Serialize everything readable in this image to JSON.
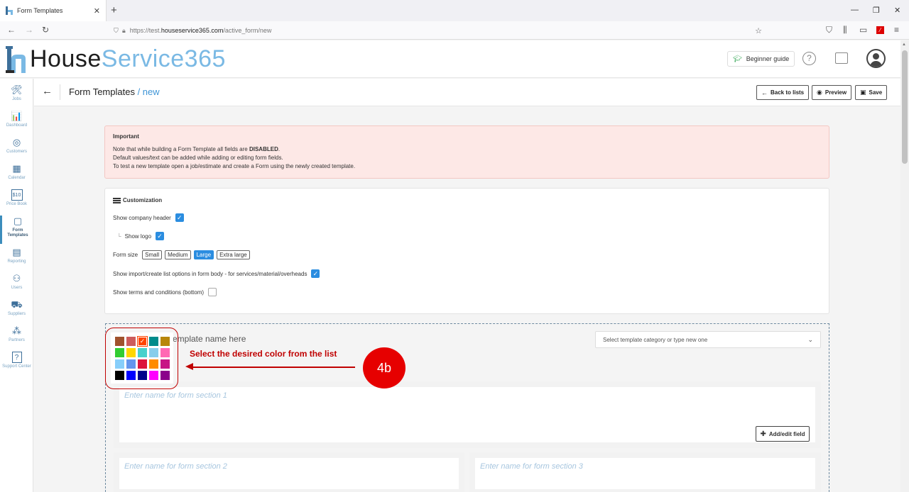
{
  "browser": {
    "tab_title": "Form Templates",
    "url_prefix": "https://test.",
    "url_domain": "houseservice365.com",
    "url_path": "/active_form/new"
  },
  "app": {
    "logo_part1": "House",
    "logo_part2": "Service365",
    "beginner_guide": "Beginner guide",
    "help_symbol": "?"
  },
  "sidebar": {
    "items": [
      {
        "label": "Jobs",
        "icon": "tools-icon",
        "glyph": "🛠"
      },
      {
        "label": "Dashboard",
        "icon": "chart-icon",
        "glyph": "📊"
      },
      {
        "label": "Customers",
        "icon": "target-icon",
        "glyph": "◎"
      },
      {
        "label": "Calendar",
        "icon": "calendar-icon",
        "glyph": "▦"
      },
      {
        "label": "Price Book",
        "icon": "pricebook-icon",
        "glyph": "$10"
      },
      {
        "label": "Form Templates",
        "icon": "form-icon",
        "glyph": "▢"
      },
      {
        "label": "Reporting",
        "icon": "report-icon",
        "glyph": "▤"
      },
      {
        "label": "Users",
        "icon": "users-icon",
        "glyph": "⚇"
      },
      {
        "label": "Suppliers",
        "icon": "truck-icon",
        "glyph": "⛟"
      },
      {
        "label": "Partners",
        "icon": "network-icon",
        "glyph": "⁂"
      },
      {
        "label": "Support Center",
        "icon": "support-icon",
        "glyph": "?"
      }
    ]
  },
  "page": {
    "title": "Form Templates",
    "title_sub": " / new",
    "back_to_lists": "Back to lists",
    "preview": "Preview",
    "save": "Save"
  },
  "important": {
    "title": "Important",
    "line1_a": "Note that while building a Form Template all fields are ",
    "line1_b": "DISABLED",
    "line1_c": ".",
    "line2": "Default values/text can be added while adding or editing form fields.",
    "line3": "To test a new template open a job/estimate and create a Form using the newly created template."
  },
  "customization": {
    "title": "Customization",
    "show_company_header": "Show company header",
    "show_logo": "Show logo",
    "form_size_label": "Form size",
    "sizes": [
      "Small",
      "Medium",
      "Large",
      "Extra large"
    ],
    "selected_size": "Large",
    "show_import": "Show import/create list options in form body - for services/material/overheads",
    "show_terms": "Show terms and conditions (bottom)"
  },
  "builder": {
    "template_name_placeholder": "Template name here",
    "template_name_visible": "emplate name here",
    "category_placeholder": "Select template category or type new one",
    "section1": "Enter name for form section 1",
    "section2": "Enter name for form section 2",
    "section3": "Enter name for form section 3",
    "add_edit_field": "Add/edit field"
  },
  "color_picker": {
    "colors": [
      "#a0522d",
      "#cd5c5c",
      "#ff4500",
      "#008b8b",
      "#b8860b",
      "#32cd32",
      "#ffd700",
      "#48d1cc",
      "#87ceeb",
      "#ff69b4",
      "#87cefa",
      "#6495ed",
      "#dc143c",
      "#ff8c00",
      "#c71585",
      "#000000",
      "#0000ff",
      "#00008b",
      "#ff00ff",
      "#8b008b"
    ],
    "selected_index": 2
  },
  "annotation": {
    "instruction": "Select the desired color from the list",
    "step": "4b"
  }
}
